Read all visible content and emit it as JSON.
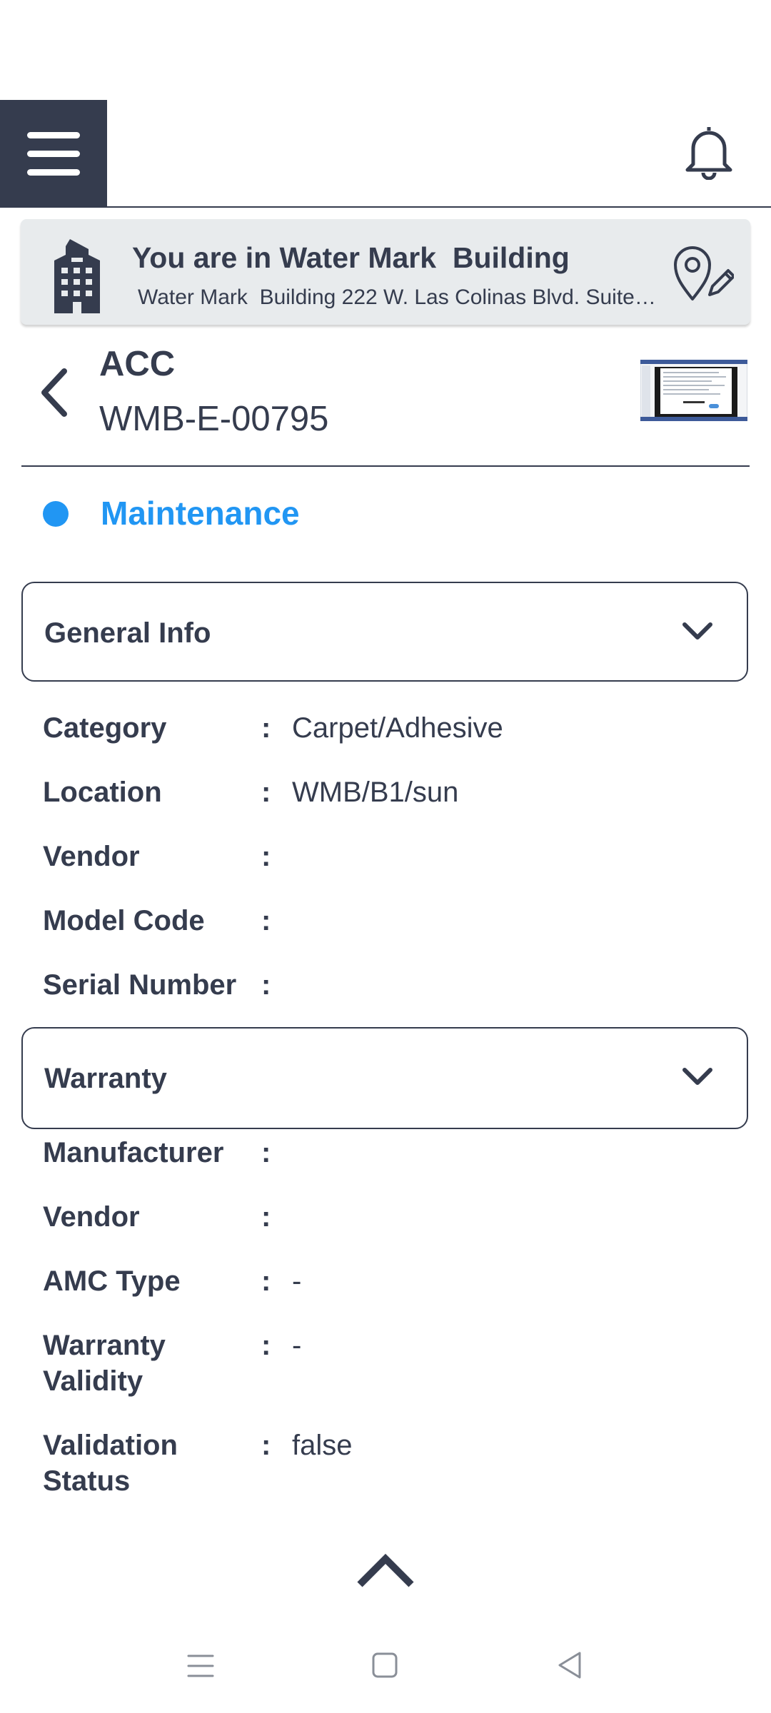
{
  "header": {
    "menu_icon": "hamburger-menu-icon",
    "bell_icon": "notification-bell-icon"
  },
  "location": {
    "title": "You are in Water Mark  Building",
    "address": "Water Mark  Building 222 W. Las Colinas Blvd. Suite 7...",
    "building_icon": "building-icon",
    "edit_location_icon": "location-pin-edit-icon"
  },
  "asset": {
    "title": "ACC",
    "code": "WMB-E-00795",
    "status": "Maintenance",
    "status_color": "#2196f3"
  },
  "general_info": {
    "label": "General Info",
    "fields": [
      {
        "label": "Category",
        "value": "Carpet/Adhesive"
      },
      {
        "label": "Location",
        "value": "WMB/B1/sun"
      },
      {
        "label": "Vendor",
        "value": ""
      },
      {
        "label": "Model Code",
        "value": ""
      },
      {
        "label": "Serial Number",
        "value": ""
      }
    ]
  },
  "warranty": {
    "label": "Warranty",
    "fields": [
      {
        "label": "Manufacturer",
        "value": ""
      },
      {
        "label": "Vendor",
        "value": ""
      },
      {
        "label": "AMC Type",
        "value": "-"
      },
      {
        "label": "Warranty Validity",
        "value": "-"
      },
      {
        "label": "Validation Status",
        "value": "false"
      }
    ]
  },
  "separator": ":",
  "colors": {
    "primary": "#353c4e",
    "accent": "#2196f3",
    "card_bg": "#e8ebed"
  }
}
